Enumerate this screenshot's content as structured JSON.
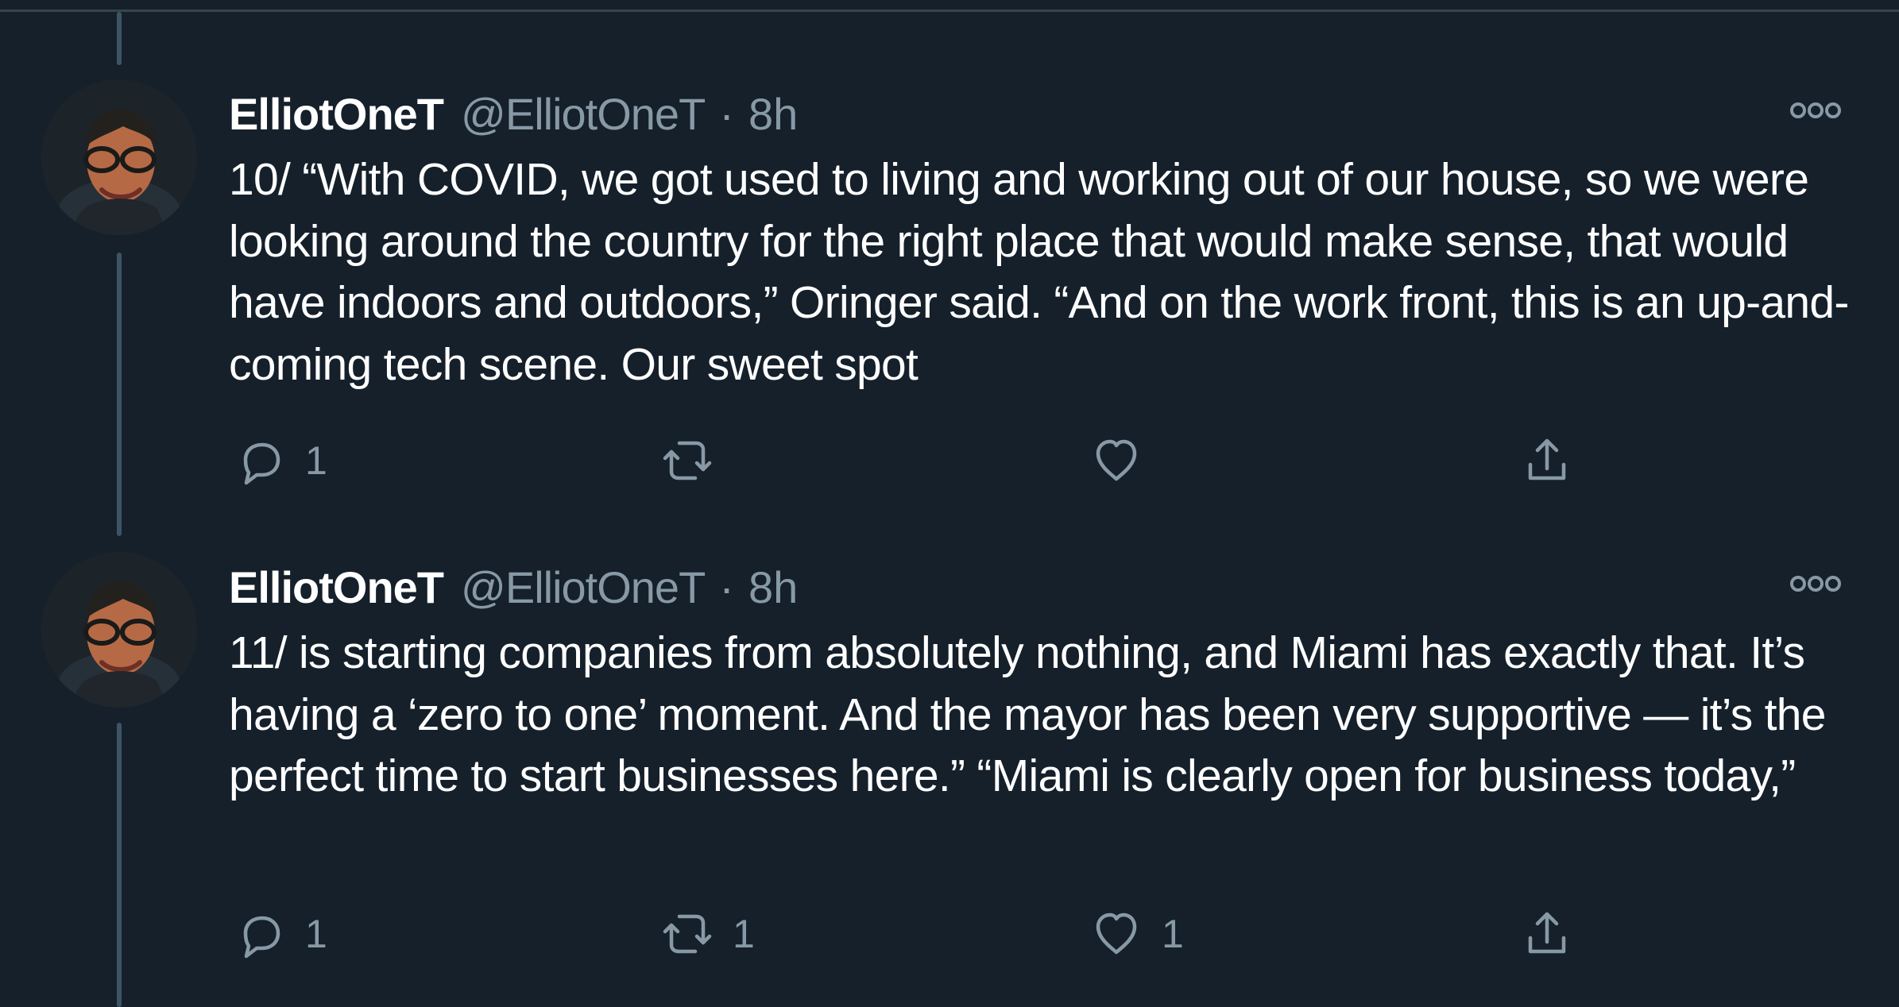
{
  "theme": {
    "background": "#15202b",
    "border": "#38444d",
    "thread_line": "#3d5466",
    "secondary_text": "#8899a6",
    "primary_text": "#ffffff"
  },
  "tweets": [
    {
      "display_name": "ElliotOneT",
      "handle": "@ElliotOneT",
      "separator": "·",
      "timestamp": "8h",
      "text": "10/ “With COVID, we got used to living and working out of our house, so we were looking around the country for the right place that would make sense, that would have indoors and outdoors,” Oringer said. “And on the work front, this is an up-and-coming tech scene. Our sweet spot",
      "reply_count": "1",
      "retweet_count": "",
      "like_count": ""
    },
    {
      "display_name": "ElliotOneT",
      "handle": "@ElliotOneT",
      "separator": "·",
      "timestamp": "8h",
      "text": "11/ is starting companies from absolutely nothing, and Miami has exactly that. It’s having a ‘zero to one’ moment. And the mayor has been very supportive — it’s the perfect time to start businesses here.”  “Miami is clearly open for business today,”",
      "reply_count": "1",
      "retweet_count": "1",
      "like_count": "1"
    }
  ],
  "icons": {
    "avatar": "profile-photo-avatar",
    "more": "more-horizontal-icon",
    "reply": "reply-icon",
    "retweet": "retweet-icon",
    "like": "heart-icon",
    "share": "share-icon"
  }
}
